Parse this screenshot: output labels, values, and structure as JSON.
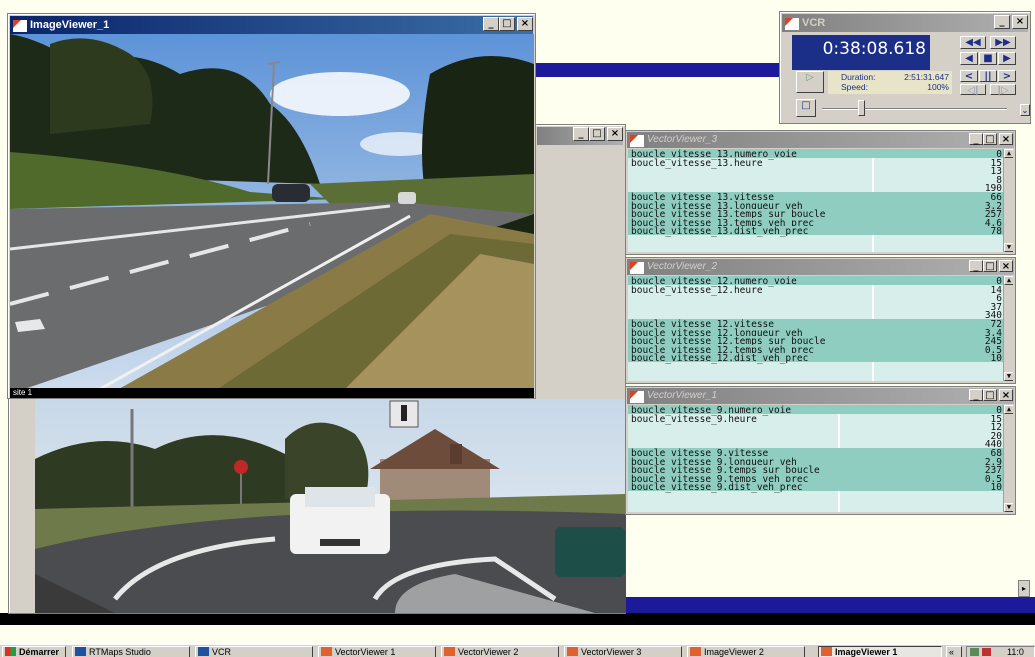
{
  "windows": {
    "image_viewer_1": {
      "title": "ImageViewer_1",
      "caption": "site 1"
    },
    "image_viewer_2": {
      "title": ""
    },
    "vcr": {
      "title": "VCR",
      "time": "0:38:08.618",
      "duration_label": "Duration:",
      "duration_value": "2:51:31.647",
      "speed_label": "Speed:",
      "speed_value": "100%"
    }
  },
  "vector_viewers": [
    {
      "title": "VectorViewer_3",
      "rows": [
        {
          "key": "boucle_vitesse_13.numero_voie",
          "values": [
            "0"
          ]
        },
        {
          "key": "boucle_vitesse_13.heure",
          "values": [
            "15",
            "13",
            "8",
            "190"
          ]
        },
        {
          "key": "boucle_vitesse_13.vitesse",
          "values": [
            "66"
          ]
        },
        {
          "key": "boucle_vitesse_13.longueur_veh",
          "values": [
            "3.2"
          ]
        },
        {
          "key": "boucle_vitesse_13.temps_sur_boucle",
          "values": [
            "257"
          ]
        },
        {
          "key": "boucle_vitesse_13.temps_veh_prec",
          "values": [
            "4.6"
          ]
        },
        {
          "key": "boucle_vitesse_13.dist_veh_prec",
          "values": [
            "78"
          ]
        }
      ]
    },
    {
      "title": "VectorViewer_2",
      "rows": [
        {
          "key": "boucle_vitesse_12.numero_voie",
          "values": [
            "0"
          ]
        },
        {
          "key": "boucle_vitesse_12.heure",
          "values": [
            "14",
            "6",
            "37",
            "340"
          ]
        },
        {
          "key": "boucle_vitesse_12.vitesse",
          "values": [
            "72"
          ]
        },
        {
          "key": "boucle_vitesse_12.longueur_veh",
          "values": [
            "3.4"
          ]
        },
        {
          "key": "boucle_vitesse_12.temps_sur_boucle",
          "values": [
            "245"
          ]
        },
        {
          "key": "boucle_vitesse_12.temps_veh_prec",
          "values": [
            "0.5"
          ]
        },
        {
          "key": "boucle_vitesse_12.dist_veh_prec",
          "values": [
            "10"
          ]
        }
      ]
    },
    {
      "title": "VectorViewer_1",
      "rows": [
        {
          "key": "boucle_vitesse_9.numero_voie",
          "values": [
            "0"
          ]
        },
        {
          "key": "boucle_vitesse_9.heure",
          "values": [
            "15",
            "12",
            "20",
            "440"
          ]
        },
        {
          "key": "boucle_vitesse_9.vitesse",
          "values": [
            "68"
          ]
        },
        {
          "key": "boucle_vitesse_9.longueur_veh",
          "values": [
            "2.9"
          ]
        },
        {
          "key": "boucle_vitesse_9.temps_sur_boucle",
          "values": [
            "237"
          ]
        },
        {
          "key": "boucle_vitesse_9.temps_veh_prec",
          "values": [
            "0.5"
          ]
        },
        {
          "key": "boucle_vitesse_9.dist_veh_prec",
          "values": [
            "10"
          ]
        }
      ]
    }
  ],
  "taskbar": {
    "start": "Démarrer",
    "items": [
      {
        "label": "RTMaps Studio"
      },
      {
        "label": "VCR"
      },
      {
        "label": "VectorViewer 1"
      },
      {
        "label": "VectorViewer 2"
      },
      {
        "label": "VectorViewer 3"
      },
      {
        "label": "ImageViewer 2"
      },
      {
        "label": "ImageViewer 1"
      }
    ],
    "clock": "11:0"
  },
  "colors": {
    "title_active": "#0a246a",
    "vcr_display": "#1c2f88",
    "vector_highlight": "#8ecdc0",
    "vector_bg": "#d8eeea"
  }
}
